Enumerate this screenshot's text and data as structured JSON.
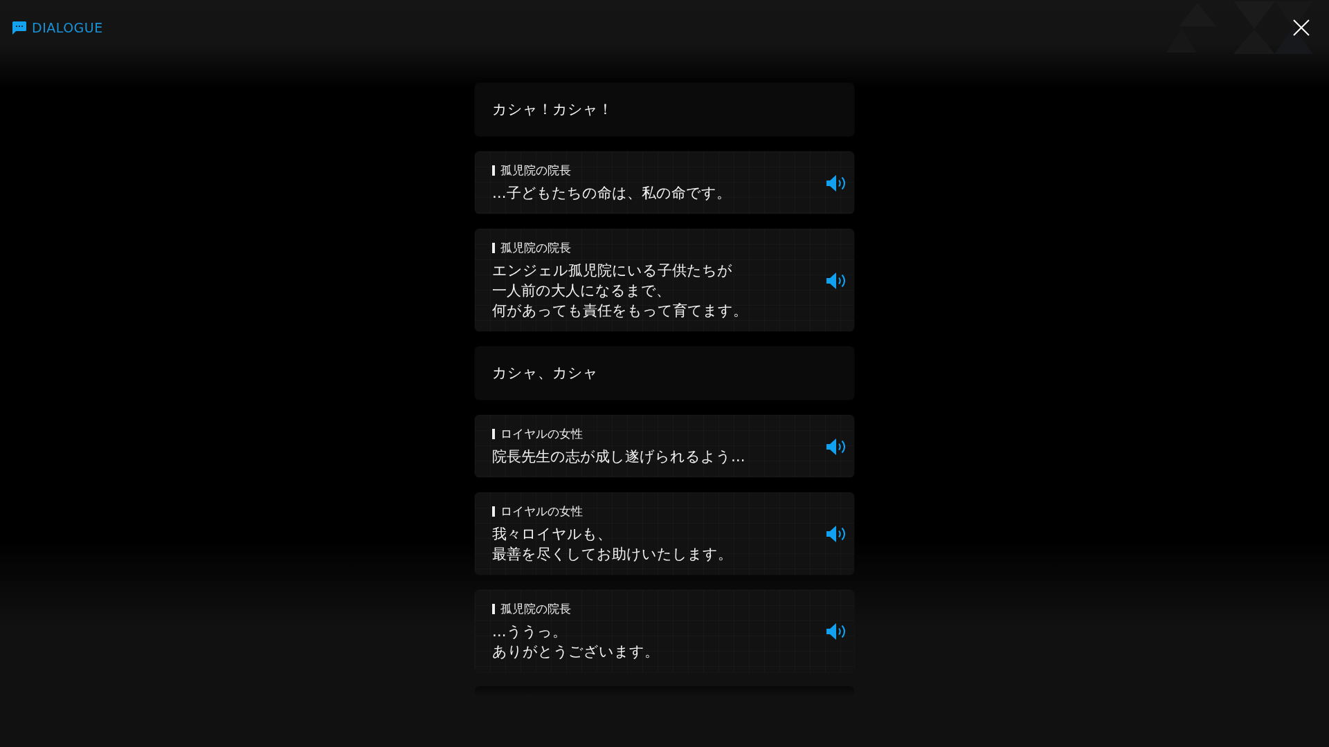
{
  "header": {
    "title": "DIALOGUE"
  },
  "entries": [
    {
      "kind": "narration",
      "lines": [
        "カシャ！カシャ！"
      ]
    },
    {
      "kind": "speech",
      "speaker": "孤児院の院長",
      "lines": [
        "…子どもたちの命は、私の命です。"
      ]
    },
    {
      "kind": "speech",
      "speaker": "孤児院の院長",
      "lines": [
        "エンジェル孤児院にいる子供たちが",
        "一人前の大人になるまで、",
        "何があっても責任をもって育てます。"
      ]
    },
    {
      "kind": "narration",
      "lines": [
        "カシャ、カシャ"
      ]
    },
    {
      "kind": "speech",
      "speaker": "ロイヤルの女性",
      "lines": [
        "院長先生の志が成し遂げられるよう…"
      ]
    },
    {
      "kind": "speech",
      "speaker": "ロイヤルの女性",
      "lines": [
        "我々ロイヤルも、",
        "最善を尽くしてお助けいたします。"
      ]
    },
    {
      "kind": "speech",
      "speaker": "孤児院の院長",
      "lines": [
        "…ううっ。",
        "ありがとうございます。"
      ]
    }
  ]
}
